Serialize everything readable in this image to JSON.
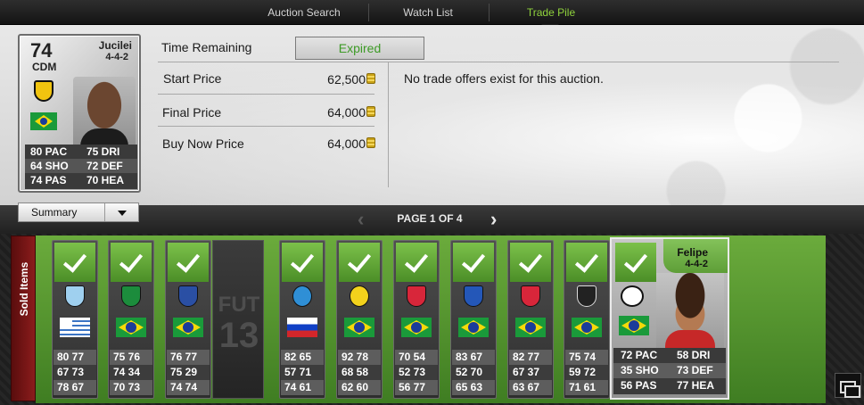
{
  "nav": {
    "tabs": [
      {
        "label": "Auction Search",
        "active": false
      },
      {
        "label": "Watch List",
        "active": false
      },
      {
        "label": "Trade Pile",
        "active": true
      }
    ]
  },
  "selected_player": {
    "rating": "74",
    "position": "CDM",
    "name": "Jucilei",
    "formation": "4-4-2",
    "club_icon": "club-crest-icon",
    "nation_icon": "brazil-flag-icon",
    "stats": [
      [
        "80 PAC",
        "75 DRI"
      ],
      [
        "64 SHO",
        "72 DEF"
      ],
      [
        "74 PAS",
        "70 HEA"
      ]
    ]
  },
  "view_dropdown": {
    "selected": "Summary"
  },
  "auction": {
    "time_remaining_label": "Time Remaining",
    "status": "Expired",
    "start_price_label": "Start Price",
    "start_price": "62,500",
    "final_price_label": "Final Price",
    "final_price": "64,000",
    "buy_now_label": "Buy Now Price",
    "buy_now_price": "64,000",
    "offers_message": "No trade offers exist for this auction."
  },
  "pagination": {
    "text": "PAGE 1 OF 4"
  },
  "sold_items": {
    "label": "Sold Items",
    "cards": [
      {
        "crest": "lazio-crest-icon",
        "flag": "uruguay-flag-icon",
        "rows": [
          "80 77",
          "67 73",
          "78 67"
        ]
      },
      {
        "crest": "sporting-crest-icon",
        "flag": "brazil-flag-icon",
        "rows": [
          "75 76",
          "74 34",
          "70 73"
        ]
      },
      {
        "crest": "porto-crest-icon",
        "flag": "brazil-flag-icon",
        "rows": [
          "76 77",
          "75 29",
          "74 74"
        ]
      },
      {
        "crest": "zenit-crest-icon",
        "flag": "russia-flag-icon",
        "rows": [
          "82 65",
          "57 71",
          "74 61"
        ]
      },
      {
        "crest": "hellas-verona-crest-icon",
        "flag": "brazil-flag-icon",
        "rows": [
          "92 78",
          "68 58",
          "62 60"
        ]
      },
      {
        "crest": "red-bull-crest-icon",
        "flag": "brazil-flag-icon",
        "rows": [
          "70 54",
          "52 73",
          "56 77"
        ]
      },
      {
        "crest": "deportivo-crest-icon",
        "flag": "brazil-flag-icon",
        "rows": [
          "83 67",
          "52 70",
          "65 63"
        ]
      },
      {
        "crest": "red-bull-crest-icon",
        "flag": "brazil-flag-icon",
        "rows": [
          "82 77",
          "67 37",
          "63 67"
        ]
      },
      {
        "crest": "atletico-mineiro-crest-icon",
        "flag": "brazil-flag-icon",
        "rows": [
          "75 74",
          "59 72",
          "71 61"
        ]
      }
    ],
    "placeholder": {
      "line1": "FUT",
      "line2": "13"
    },
    "focused": {
      "name": "Felipe",
      "formation": "4-4-2",
      "crest": "hannover-96-crest-icon",
      "flag": "brazil-flag-icon",
      "stats": [
        [
          "72 PAC",
          "58 DRI"
        ],
        [
          "35 SHO",
          "73 DEF"
        ],
        [
          "56 PAS",
          "77 HEA"
        ]
      ]
    }
  },
  "colors": {
    "accent_green": "#8fd23c",
    "expired_green": "#3c9a25",
    "sold_red": "#8b1c1c"
  }
}
